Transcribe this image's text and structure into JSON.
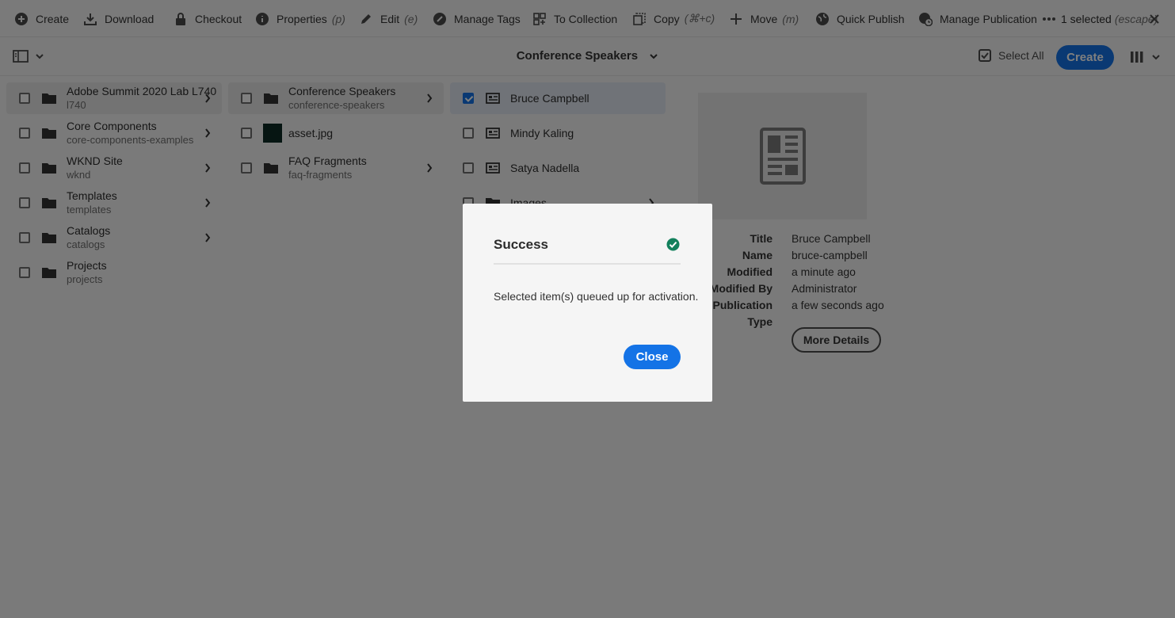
{
  "toolbar": {
    "actions": [
      {
        "label": "Create",
        "shortcut": ""
      },
      {
        "label": "Download",
        "shortcut": ""
      },
      {
        "label": "Checkout",
        "shortcut": ""
      },
      {
        "label": "Properties",
        "shortcut": "(p)"
      },
      {
        "label": "Edit",
        "shortcut": "(e)"
      },
      {
        "label": "Manage Tags",
        "shortcut": ""
      },
      {
        "label": "To Collection",
        "shortcut": ""
      },
      {
        "label": "Copy",
        "shortcut": "(⌘+c)"
      },
      {
        "label": "Move",
        "shortcut": "(m)"
      },
      {
        "label": "Quick Publish",
        "shortcut": ""
      },
      {
        "label": "Manage Publication",
        "shortcut": ""
      }
    ],
    "selection_count": "1 selected",
    "selection_shortcut": "(escape)"
  },
  "subbar": {
    "breadcrumb": "Conference Speakers",
    "select_all_label": "Select All",
    "create_label": "Create"
  },
  "columns": {
    "col1": [
      {
        "title": "Adobe Summit 2020 Lab L740",
        "sub": "l740"
      },
      {
        "title": "Core Components",
        "sub": "core-components-examples"
      },
      {
        "title": "WKND Site",
        "sub": "wknd"
      },
      {
        "title": "Templates",
        "sub": "templates"
      },
      {
        "title": "Catalogs",
        "sub": "catalogs"
      },
      {
        "title": "Projects",
        "sub": "projects"
      }
    ],
    "col2": [
      {
        "title": "Conference Speakers",
        "sub": "conference-speakers"
      },
      {
        "title": "asset.jpg",
        "sub": ""
      },
      {
        "title": "FAQ Fragments",
        "sub": "faq-fragments"
      }
    ],
    "col3": [
      {
        "title": "Bruce Campbell"
      },
      {
        "title": "Mindy Kaling"
      },
      {
        "title": "Satya Nadella"
      },
      {
        "title": "Images"
      }
    ]
  },
  "details": {
    "labels": [
      "Title",
      "Name",
      "Modified",
      "Modified By",
      "Publication",
      "Type"
    ],
    "values": [
      "Bruce Campbell",
      "bruce-campbell",
      "a minute ago",
      "Administrator",
      "a few seconds ago",
      ""
    ],
    "more_details_label": "More Details"
  },
  "dialog": {
    "title": "Success",
    "message": "Selected item(s) queued up for activation.",
    "close_label": "Close",
    "status_color": "#12805c"
  },
  "colors": {
    "accent": "#1473e6"
  }
}
